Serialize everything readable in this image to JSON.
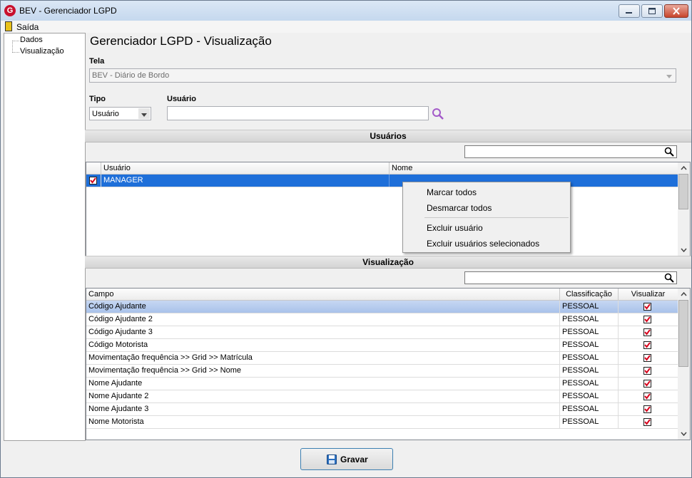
{
  "window": {
    "title": "BEV - Gerenciador LGPD"
  },
  "menu": {
    "exit_label": "Saída"
  },
  "tree": {
    "items": [
      "Dados",
      "Visualização"
    ]
  },
  "page": {
    "title": "Gerenciador LGPD - Visualização"
  },
  "form": {
    "tela_label": "Tela",
    "tela_value": "BEV - Diário de Bordo",
    "tipo_label": "Tipo",
    "tipo_value": "Usuário",
    "usuario_label": "Usuário",
    "usuario_value": ""
  },
  "users_section": {
    "title": "Usuários",
    "search_value": "",
    "columns": [
      "Usuário",
      "Nome"
    ],
    "rows": [
      {
        "checked": true,
        "usuario": "MANAGER",
        "nome": ""
      }
    ]
  },
  "context_menu": {
    "items": [
      "Marcar todos",
      "Desmarcar todos",
      "Excluir usuário",
      "Excluir usuários selecionados"
    ]
  },
  "view_section": {
    "title": "Visualização",
    "search_value": "",
    "columns": [
      "Campo",
      "Classificação",
      "Visualizar"
    ],
    "rows": [
      {
        "campo": "Código Ajudante",
        "classificacao": "PESSOAL",
        "visualizar": true
      },
      {
        "campo": "Código Ajudante 2",
        "classificacao": "PESSOAL",
        "visualizar": true
      },
      {
        "campo": "Código Ajudante 3",
        "classificacao": "PESSOAL",
        "visualizar": true
      },
      {
        "campo": "Código Motorista",
        "classificacao": "PESSOAL",
        "visualizar": true
      },
      {
        "campo": "Movimentação frequência >> Grid >> Matrícula",
        "classificacao": "PESSOAL",
        "visualizar": true
      },
      {
        "campo": "Movimentação frequência >> Grid >> Nome",
        "classificacao": "PESSOAL",
        "visualizar": true
      },
      {
        "campo": "Nome Ajudante",
        "classificacao": "PESSOAL",
        "visualizar": true
      },
      {
        "campo": "Nome Ajudante 2",
        "classificacao": "PESSOAL",
        "visualizar": true
      },
      {
        "campo": "Nome Ajudante 3",
        "classificacao": "PESSOAL",
        "visualizar": true
      },
      {
        "campo": "Nome Motorista",
        "classificacao": "PESSOAL",
        "visualizar": true
      }
    ]
  },
  "footer": {
    "save_label": "Gravar"
  },
  "colors": {
    "selection": "#1e6fd9",
    "focus_row": "#b7cbee",
    "check": "#d6001c",
    "search_icon_accent": "#a35ac9"
  }
}
